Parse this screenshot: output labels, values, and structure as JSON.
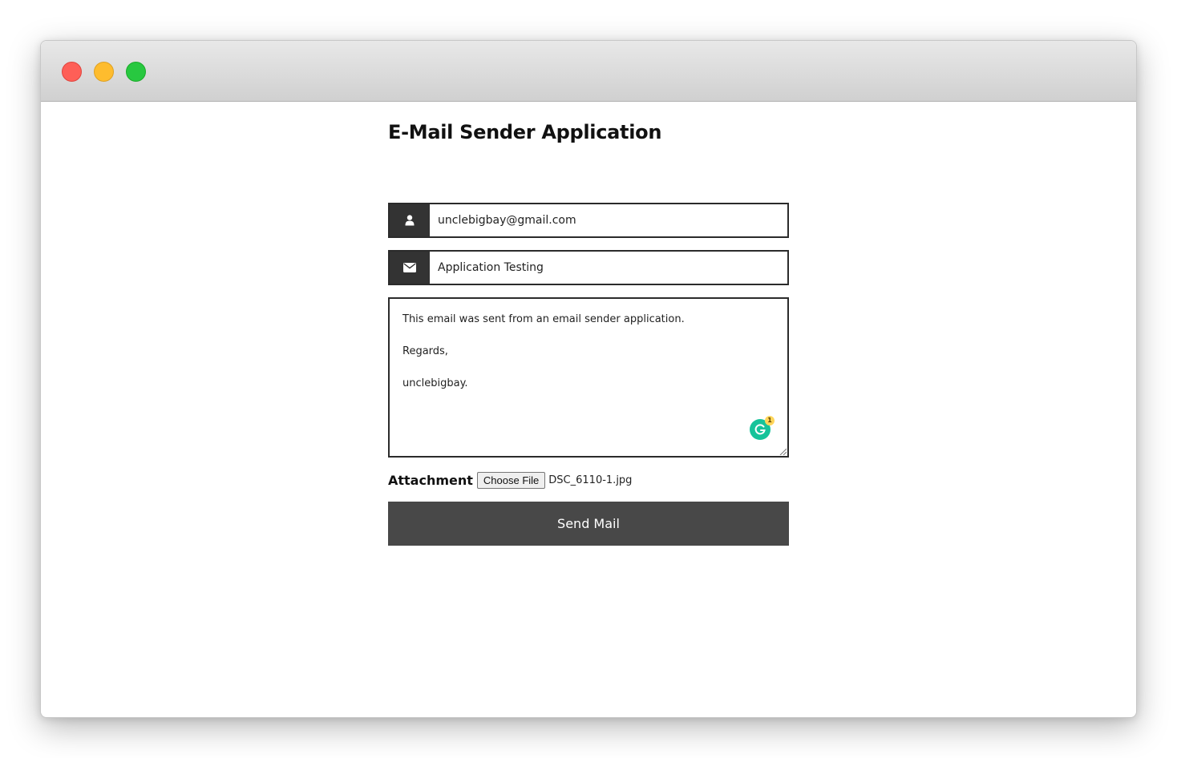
{
  "window": {
    "controls": [
      "close",
      "minimize",
      "maximize"
    ]
  },
  "page": {
    "title": "E-Mail Sender Application"
  },
  "form": {
    "to": {
      "icon": "user-icon",
      "value": "unclebigbay@gmail.com"
    },
    "subject": {
      "icon": "envelope-icon",
      "value": "Application Testing"
    },
    "message": {
      "lines": [
        "This email was sent from an email sender application.",
        "Regards,",
        "unclebigbay."
      ]
    },
    "grammarly": {
      "badge_count": "1"
    },
    "attachment": {
      "label": "Attachment",
      "button_label": "Choose File",
      "file_name": "DSC_6110-1.jpg"
    },
    "submit": {
      "label": "Send Mail"
    }
  },
  "colors": {
    "close": "#fe5f57",
    "minimize": "#febc2e",
    "maximize": "#28c840",
    "icon_bg": "#333333",
    "button_bg": "#484848",
    "grammarly": "#15c39a"
  }
}
